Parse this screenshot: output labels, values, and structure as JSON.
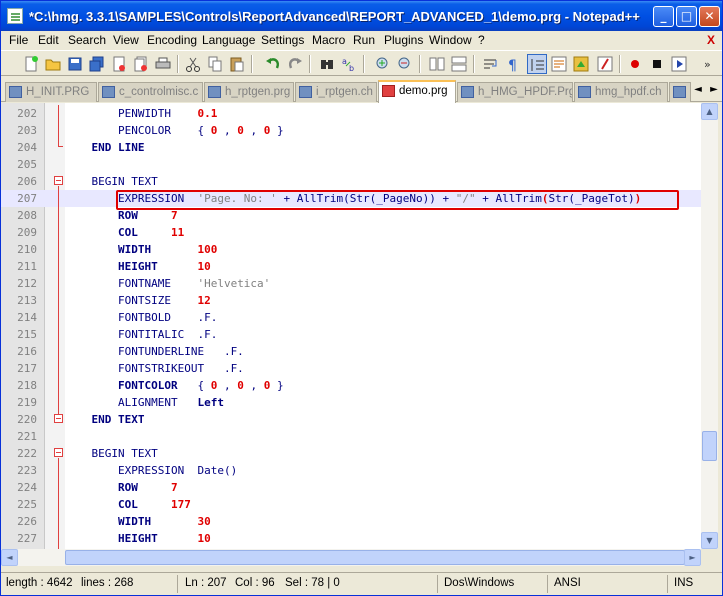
{
  "window": {
    "title": "*C:\\hmg. 3.3.1\\SAMPLES\\Controls\\ReportAdvanced\\REPORT_ADVANCED_1\\demo.prg - Notepad++",
    "min_label": "_",
    "max_label": "□",
    "close_label": "✕"
  },
  "menu": [
    "File",
    "Edit",
    "Search",
    "View",
    "Encoding",
    "Language",
    "Settings",
    "Macro",
    "Run",
    "Plugins",
    "Window",
    "?"
  ],
  "menu_close": "X",
  "tabs": [
    {
      "label": "H_INIT.PRG"
    },
    {
      "label": "c_controlmisc.c"
    },
    {
      "label": "h_rptgen.prg"
    },
    {
      "label": "i_rptgen.ch"
    },
    {
      "label": "demo.prg"
    },
    {
      "label": "h_HMG_HPDF.Prg"
    },
    {
      "label": "hmg_hpdf.ch"
    },
    {
      "label": ""
    }
  ],
  "tab_nav": {
    "left": "◄",
    "right": "►"
  },
  "lines": [
    {
      "n": "202",
      "parts": [
        {
          "t": "        PENWIDTH    ",
          "c": "kw2"
        },
        {
          "t": "0.1",
          "c": "num"
        }
      ]
    },
    {
      "n": "203",
      "parts": [
        {
          "t": "        PENCOLOR    { ",
          "c": "kw2"
        },
        {
          "t": "0",
          "c": "num"
        },
        {
          "t": " , ",
          "c": "kw2"
        },
        {
          "t": "0",
          "c": "num"
        },
        {
          "t": " , ",
          "c": "kw2"
        },
        {
          "t": "0",
          "c": "num"
        },
        {
          "t": " }",
          "c": "kw2"
        }
      ]
    },
    {
      "n": "204",
      "parts": [
        {
          "t": "    END LINE",
          "c": "kw"
        }
      ]
    },
    {
      "n": "205",
      "parts": []
    },
    {
      "n": "206",
      "parts": [
        {
          "t": "    BEGIN TEXT",
          "c": "kw2"
        }
      ]
    },
    {
      "n": "207",
      "parts": [
        {
          "t": "        EXPRESSION  ",
          "c": "kw2"
        },
        {
          "t": "'Page. No: '",
          "c": "str"
        },
        {
          "t": " + AllTrim(Str(_PageNo)) + ",
          "c": "kw2"
        },
        {
          "t": "\"/\"",
          "c": "str"
        },
        {
          "t": " + AllTrim",
          "c": "kw2"
        },
        {
          "t": "(",
          "c": "num"
        },
        {
          "t": "Str(_PageTot)",
          "c": "kw2"
        },
        {
          "t": ")",
          "c": "num"
        }
      ]
    },
    {
      "n": "208",
      "parts": [
        {
          "t": "        ROW     ",
          "c": "kw"
        },
        {
          "t": "7",
          "c": "num"
        }
      ]
    },
    {
      "n": "209",
      "parts": [
        {
          "t": "        COL     ",
          "c": "kw"
        },
        {
          "t": "11",
          "c": "num"
        }
      ]
    },
    {
      "n": "210",
      "parts": [
        {
          "t": "        WIDTH       ",
          "c": "kw"
        },
        {
          "t": "100",
          "c": "num"
        }
      ]
    },
    {
      "n": "211",
      "parts": [
        {
          "t": "        HEIGHT      ",
          "c": "kw"
        },
        {
          "t": "10",
          "c": "num"
        }
      ]
    },
    {
      "n": "212",
      "parts": [
        {
          "t": "        FONTNAME    ",
          "c": "kw2"
        },
        {
          "t": "'Helvetica'",
          "c": "str"
        }
      ]
    },
    {
      "n": "213",
      "parts": [
        {
          "t": "        FONTSIZE    ",
          "c": "kw2"
        },
        {
          "t": "12",
          "c": "num"
        }
      ]
    },
    {
      "n": "214",
      "parts": [
        {
          "t": "        FONTBOLD    .F.",
          "c": "kw2"
        }
      ]
    },
    {
      "n": "215",
      "parts": [
        {
          "t": "        FONTITALIC  .F.",
          "c": "kw2"
        }
      ]
    },
    {
      "n": "216",
      "parts": [
        {
          "t": "        FONTUNDERLINE   .F.",
          "c": "kw2"
        }
      ]
    },
    {
      "n": "217",
      "parts": [
        {
          "t": "        FONTSTRIKEOUT   .F.",
          "c": "kw2"
        }
      ]
    },
    {
      "n": "218",
      "parts": [
        {
          "t": "        FONTCOLOR   ",
          "c": "kw"
        },
        {
          "t": "{ ",
          "c": "kw2"
        },
        {
          "t": "0",
          "c": "num"
        },
        {
          "t": " , ",
          "c": "kw2"
        },
        {
          "t": "0",
          "c": "num"
        },
        {
          "t": " , ",
          "c": "kw2"
        },
        {
          "t": "0",
          "c": "num"
        },
        {
          "t": " }",
          "c": "kw2"
        }
      ]
    },
    {
      "n": "219",
      "parts": [
        {
          "t": "        ALIGNMENT   ",
          "c": "kw2"
        },
        {
          "t": "Left",
          "c": "kw"
        }
      ]
    },
    {
      "n": "220",
      "parts": [
        {
          "t": "    END TEXT",
          "c": "kw"
        }
      ]
    },
    {
      "n": "221",
      "parts": []
    },
    {
      "n": "222",
      "parts": [
        {
          "t": "    BEGIN TEXT",
          "c": "kw2"
        }
      ]
    },
    {
      "n": "223",
      "parts": [
        {
          "t": "        EXPRESSION  Date()",
          "c": "kw2"
        }
      ]
    },
    {
      "n": "224",
      "parts": [
        {
          "t": "        ROW     ",
          "c": "kw"
        },
        {
          "t": "7",
          "c": "num"
        }
      ]
    },
    {
      "n": "225",
      "parts": [
        {
          "t": "        COL     ",
          "c": "kw"
        },
        {
          "t": "177",
          "c": "num"
        }
      ]
    },
    {
      "n": "226",
      "parts": [
        {
          "t": "        WIDTH       ",
          "c": "kw"
        },
        {
          "t": "30",
          "c": "num"
        }
      ]
    },
    {
      "n": "227",
      "parts": [
        {
          "t": "        HEIGHT      ",
          "c": "kw"
        },
        {
          "t": "10",
          "c": "num"
        }
      ]
    }
  ],
  "current_line": "207",
  "status": {
    "length": "length : 4642",
    "lines": "lines : 268",
    "ln": "Ln : 207",
    "col": "Col : 96",
    "sel": "Sel : 78 | 0",
    "eol": "Dos\\Windows",
    "encoding": "ANSI",
    "mode": "INS"
  },
  "colors": {
    "keyword": "#00007f",
    "number": "#e00000",
    "string": "#808080",
    "highlight": "#e00000",
    "title_bar": "#0050e4"
  }
}
